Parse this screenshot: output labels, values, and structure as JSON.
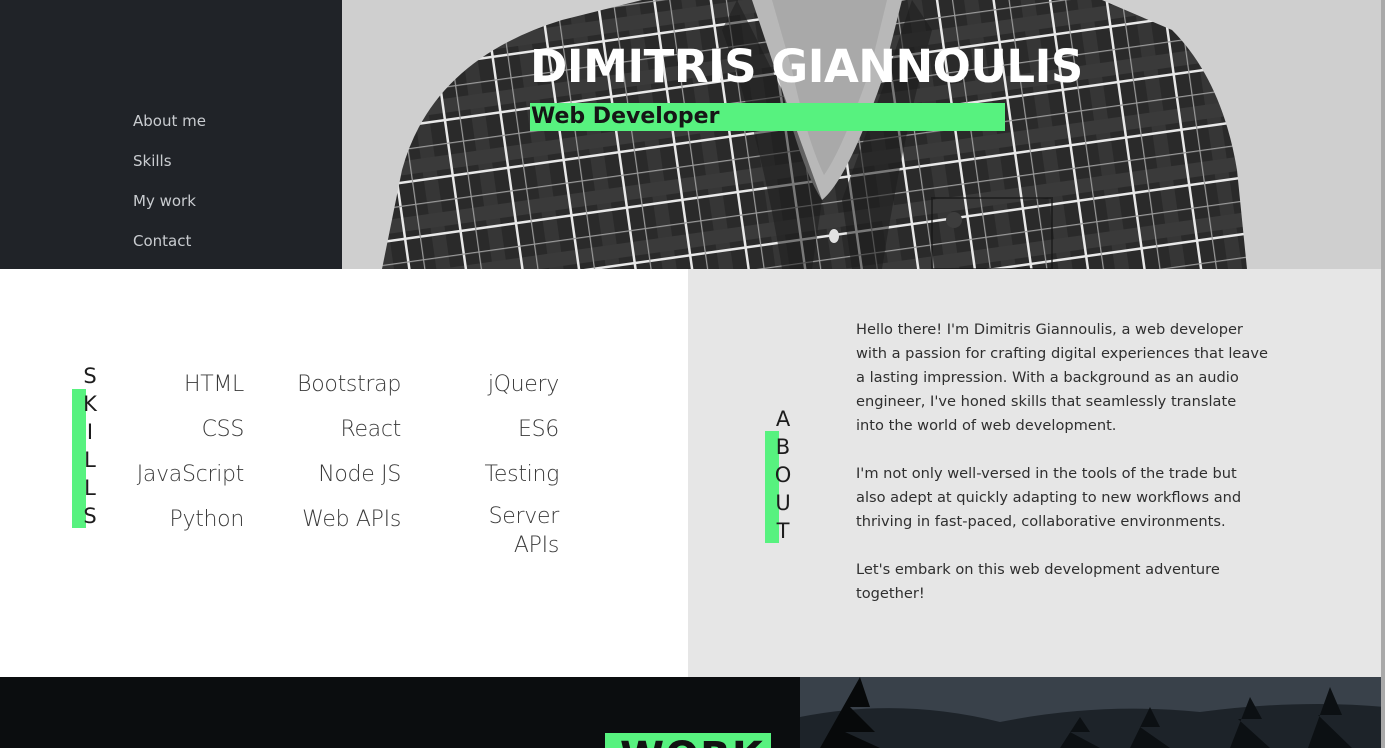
{
  "nav": {
    "items": [
      {
        "label": "About me"
      },
      {
        "label": "Skills"
      },
      {
        "label": "My work"
      },
      {
        "label": "Contact"
      }
    ]
  },
  "hero": {
    "name": "DIMITRIS GIANNOULIS",
    "role": "Web Developer"
  },
  "skills": {
    "heading_letters": [
      "S",
      "K",
      "I",
      "L",
      "L",
      "S"
    ],
    "columns": [
      [
        "HTML",
        "CSS",
        "JavaScript",
        "Python"
      ],
      [
        "Bootstrap",
        "React",
        "Node JS",
        "Web APIs"
      ],
      [
        "jQuery",
        "ES6",
        "Testing",
        "Server APIs"
      ]
    ]
  },
  "about": {
    "heading_letters": [
      "A",
      "B",
      "O",
      "U",
      "T"
    ],
    "paragraphs": [
      "Hello there! I'm Dimitris Giannoulis, a web developer with a passion for crafting digital experiences that leave a lasting impression. With a background as an audio engineer, I've honed skills that seamlessly translate into the world of web development.",
      "I'm not only well-versed in the tools of the trade but also adept at quickly adapting to new workflows and thriving in fast-paced, collaborative environments.",
      "Let's embark on this web development adventure together!"
    ]
  },
  "work": {
    "title": "WORK"
  },
  "colors": {
    "accent": "#57f27f",
    "sidebar": "#202328",
    "about_bg": "#e6e6e6"
  }
}
